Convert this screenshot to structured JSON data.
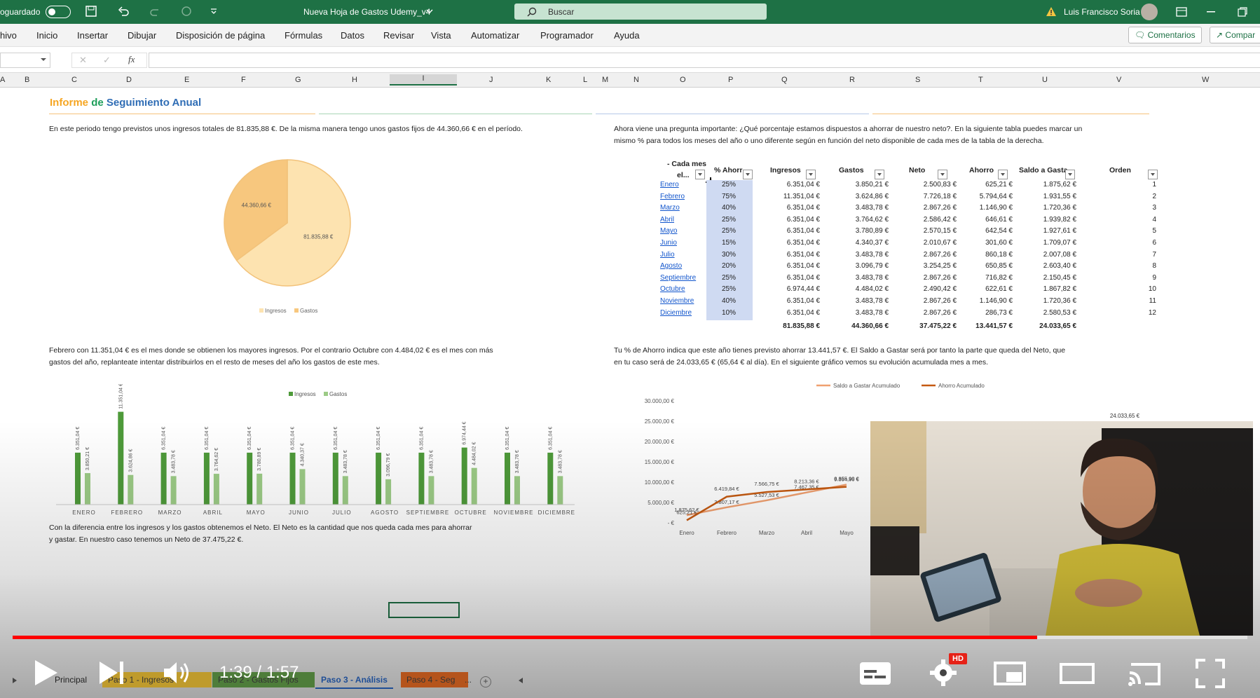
{
  "titlebar": {
    "autosave_label": "oguardado",
    "doc_title": "Nueva Hoja de Gastos Udemy_v4",
    "search_placeholder": "Buscar",
    "user_name": "Luis Francisco Soria",
    "brand_color": "#1e7145"
  },
  "ribbon": {
    "menu": [
      "hivo",
      "Inicio",
      "Insertar",
      "Dibujar",
      "Disposición de página",
      "Fórmulas",
      "Datos",
      "Revisar",
      "Vista",
      "Automatizar",
      "Programador",
      "Ayuda"
    ],
    "comments_label": "Comentarios",
    "share_label": "Compar"
  },
  "columns": [
    "A",
    "B",
    "C",
    "D",
    "E",
    "F",
    "G",
    "H",
    "I",
    "J",
    "K",
    "L",
    "M",
    "N",
    "O",
    "P",
    "Q",
    "R",
    "S",
    "T",
    "U",
    "V",
    "W"
  ],
  "report": {
    "title_a": "Informe",
    "title_b": "de",
    "title_c": "Seguimiento Anual",
    "intro": "En este periodo tengo previstos unos ingresos totales de 81.835,88 €. De la misma manera tengo unos gastos fijos de 44.360,66 € en el período.",
    "question_1": "Ahora viene una pregunta importante: ¿Qué porcentaje estamos dispuestos a ahorrar de nuestro neto?. En la siguiente tabla puedes marcar un",
    "question_2": "mismo % para todos los meses del año o uno diferente según en función del neto disponible de cada mes de la tabla de la derecha.",
    "feb_1": "Febrero con 11.351,04 € es el mes donde se obtienen los mayores ingresos. Por el contrario Octubre con 4.484,02 € es el mes con más",
    "feb_2": "gastos del año, replanteate intentar distribuirlos en el resto de meses del año los gastos de este mes.",
    "ahorro_1": "Tu % de Ahorro indica que este año tienes previsto ahorrar 13.441,57 €. El Saldo a Gastar será por tanto la parte que queda del Neto, que",
    "ahorro_2": "en tu caso será de 24.033,65 € (65,64 € al día). En el siguiente gráfico vemos su evolución acumulada mes a mes.",
    "neto_1": "Con la diferencia entre los ingresos y los gastos obtenemos el Neto. El Neto es la cantidad que nos queda cada mes para ahorrar",
    "neto_2": "y gastar. En nuestro caso tenemos un Neto de 37.475,22 €."
  },
  "table": {
    "headers": {
      "mes_1": "- Cada mes",
      "mes_2": "el...",
      "ahorro_pct": "% Ahorr",
      "ingresos": "Ingresos",
      "gastos": "Gastos",
      "neto": "Neto",
      "ahorro": "Ahorro",
      "saldo": "Saldo a Gasta",
      "orden": "Orden"
    },
    "rows": [
      {
        "mes": "Enero",
        "pct": "25%",
        "ingresos": "6.351,04 €",
        "gastos": "3.850,21 €",
        "neto": "2.500,83 €",
        "ahorro": "625,21 €",
        "saldo": "1.875,62 €",
        "orden": "1"
      },
      {
        "mes": "Febrero",
        "pct": "75%",
        "ingresos": "11.351,04 €",
        "gastos": "3.624,86 €",
        "neto": "7.726,18 €",
        "ahorro": "5.794,64 €",
        "saldo": "1.931,55 €",
        "orden": "2"
      },
      {
        "mes": "Marzo",
        "pct": "40%",
        "ingresos": "6.351,04 €",
        "gastos": "3.483,78 €",
        "neto": "2.867,26 €",
        "ahorro": "1.146,90 €",
        "saldo": "1.720,36 €",
        "orden": "3"
      },
      {
        "mes": "Abril",
        "pct": "25%",
        "ingresos": "6.351,04 €",
        "gastos": "3.764,62 €",
        "neto": "2.586,42 €",
        "ahorro": "646,61 €",
        "saldo": "1.939,82 €",
        "orden": "4"
      },
      {
        "mes": "Mayo",
        "pct": "25%",
        "ingresos": "6.351,04 €",
        "gastos": "3.780,89 €",
        "neto": "2.570,15 €",
        "ahorro": "642,54 €",
        "saldo": "1.927,61 €",
        "orden": "5"
      },
      {
        "mes": "Junio",
        "pct": "15%",
        "ingresos": "6.351,04 €",
        "gastos": "4.340,37 €",
        "neto": "2.010,67 €",
        "ahorro": "301,60 €",
        "saldo": "1.709,07 €",
        "orden": "6"
      },
      {
        "mes": "Julio",
        "pct": "30%",
        "ingresos": "6.351,04 €",
        "gastos": "3.483,78 €",
        "neto": "2.867,26 €",
        "ahorro": "860,18 €",
        "saldo": "2.007,08 €",
        "orden": "7"
      },
      {
        "mes": "Agosto",
        "pct": "20%",
        "ingresos": "6.351,04 €",
        "gastos": "3.096,79 €",
        "neto": "3.254,25 €",
        "ahorro": "650,85 €",
        "saldo": "2.603,40 €",
        "orden": "8"
      },
      {
        "mes": "Septiembre",
        "pct": "25%",
        "ingresos": "6.351,04 €",
        "gastos": "3.483,78 €",
        "neto": "2.867,26 €",
        "ahorro": "716,82 €",
        "saldo": "2.150,45 €",
        "orden": "9"
      },
      {
        "mes": "Octubre",
        "pct": "25%",
        "ingresos": "6.974,44 €",
        "gastos": "4.484,02 €",
        "neto": "2.490,42 €",
        "ahorro": "622,61 €",
        "saldo": "1.867,82 €",
        "orden": "10"
      },
      {
        "mes": "Noviembre",
        "pct": "40%",
        "ingresos": "6.351,04 €",
        "gastos": "3.483,78 €",
        "neto": "2.867,26 €",
        "ahorro": "1.146,90 €",
        "saldo": "1.720,36 €",
        "orden": "11"
      },
      {
        "mes": "Diciembre",
        "pct": "10%",
        "ingresos": "6.351,04 €",
        "gastos": "3.483,78 €",
        "neto": "2.867,26 €",
        "ahorro": "286,73 €",
        "saldo": "2.580,53 €",
        "orden": "12"
      }
    ],
    "totals": {
      "ingresos": "81.835,88 €",
      "gastos": "44.360,66 €",
      "neto": "37.475,22 €",
      "ahorro": "13.441,57 €",
      "saldo": "24.033,65 €"
    }
  },
  "chart_data": [
    {
      "type": "pie",
      "categories": [
        "Ingresos",
        "Gastos"
      ],
      "values": [
        81835.88,
        44360.66
      ],
      "data_labels": [
        "81.835,88 €",
        "44.360,66 €"
      ],
      "colors": [
        "#fde3b0",
        "#f7c77e"
      ],
      "legend": "bottom"
    },
    {
      "type": "bar",
      "categories": [
        "ENERO",
        "FEBRERO",
        "MARZO",
        "ABRIL",
        "MAYO",
        "JUNIO",
        "JULIO",
        "AGOSTO",
        "SEPTIEMBRE",
        "OCTUBRE",
        "NOVIEMBRE",
        "DICIEMBRE"
      ],
      "series": [
        {
          "name": "Ingresos",
          "color": "#4e9a3a",
          "values": [
            6351.04,
            11351.04,
            6351.04,
            6351.04,
            6351.04,
            6351.04,
            6351.04,
            6351.04,
            6351.04,
            6974.44,
            6351.04,
            6351.04
          ],
          "labels": [
            "6.351,04 €",
            "11.351,04 €",
            "6.351,04 €",
            "6.351,04 €",
            "6.351,04 €",
            "6.351,04 €",
            "6.351,04 €",
            "6.351,04 €",
            "6.351,04 €",
            "6.974,44 €",
            "6.351,04 €",
            "6.351,04 €"
          ]
        },
        {
          "name": "Gastos",
          "color": "#9ccb86",
          "values": [
            3850.21,
            3624.86,
            3483.78,
            3764.62,
            3780.89,
            4340.37,
            3483.78,
            3096.79,
            3483.78,
            4484.02,
            3483.78,
            3483.78
          ],
          "labels": [
            "3.850,21 €",
            "3.624,86 €",
            "3.483,78 €",
            "3.764,62 €",
            "3.780,89 €",
            "4.340,37 €",
            "3.483,78 €",
            "3.096,79 €",
            "3.483,78 €",
            "4.484,02 €",
            "3.483,78 €",
            "3.483,78 €"
          ]
        }
      ],
      "legend": "top"
    },
    {
      "type": "line",
      "x": [
        "Enero",
        "Febrero",
        "Marzo",
        "Abril",
        "Mayo"
      ],
      "y_ticks": [
        "30.000,00 €",
        "25.000,00 €",
        "20.000,00 €",
        "15.000,00 €",
        "10.000,00 €",
        "5.000,00 €",
        "- €"
      ],
      "ylim": [
        0,
        30000
      ],
      "series": [
        {
          "name": "Saldo a Gastar Acumulado",
          "color": "#f0a070",
          "values": [
            1875.62,
            3807.17,
            5527.53,
            7467.35,
            9394.96
          ],
          "labels": [
            "1.875,62 €",
            "3.807,17 €",
            "5.527,53 €",
            "7.467,35 €",
            "9.394,96 €"
          ]
        },
        {
          "name": "Ahorro Acumulado",
          "color": "#c55a11",
          "values": [
            625.21,
            6419.84,
            7566.75,
            8213.36,
            8855.9
          ],
          "labels": [
            "625,21 €",
            "6.419,84 €",
            "7.566,75 €",
            "8.213,36 €",
            "8.855,90 €"
          ]
        }
      ],
      "end_label": "24.033,65 €",
      "legend": "top"
    }
  ],
  "video": {
    "time": "1:39 / 1:57",
    "progress": 0.83,
    "hd_badge": "HD"
  },
  "sheet_tabs": [
    "Principal",
    "Paso 1 - Ingresos",
    "Paso 2 - Gastos Fijos",
    "Paso 3 - Análisis",
    "Paso 4 - Seg"
  ],
  "sheet_tab_more": "..."
}
